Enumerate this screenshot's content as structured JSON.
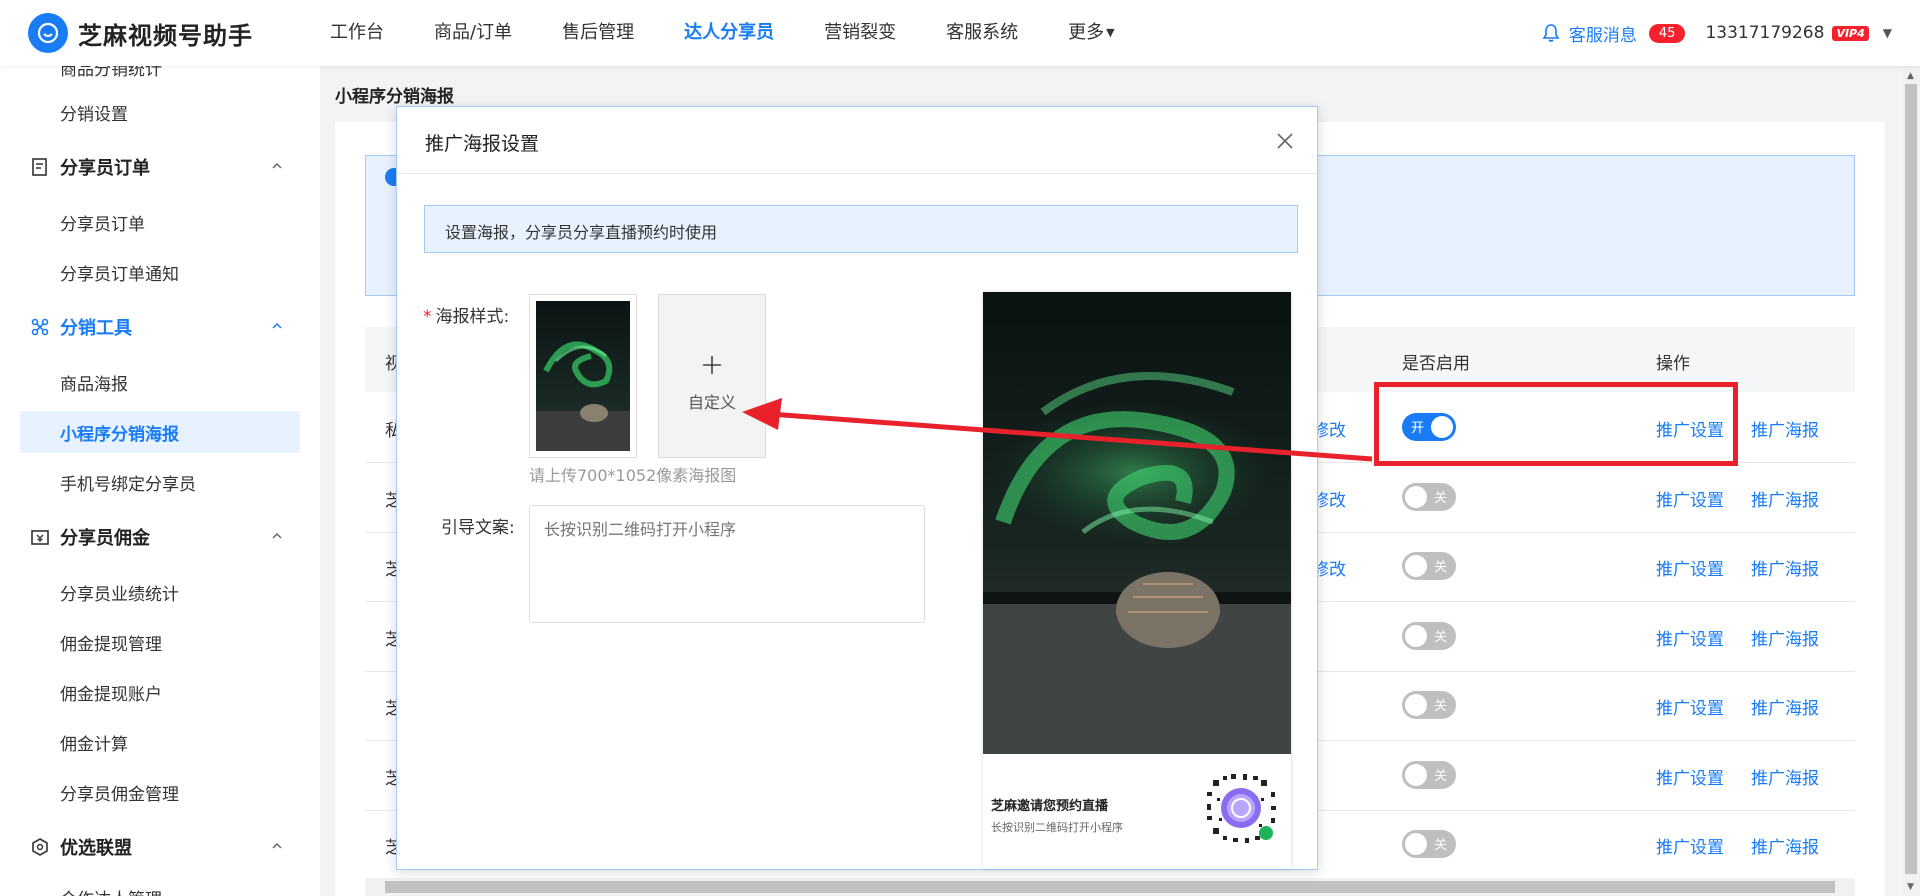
{
  "header": {
    "app_name": "芝麻视频号助手",
    "nav": [
      {
        "label": "工作台",
        "active": false
      },
      {
        "label": "商品/订单",
        "active": false
      },
      {
        "label": "售后管理",
        "active": false
      },
      {
        "label": "达人分享员",
        "active": true
      },
      {
        "label": "营销裂变",
        "active": false
      },
      {
        "label": "客服系统",
        "active": false
      },
      {
        "label": "更多",
        "active": false
      }
    ],
    "service_msg_label": "客服消息",
    "service_msg_count": "45",
    "account": "13317179268",
    "vip_badge": "VIP4"
  },
  "sidebar": {
    "items": [
      {
        "type": "sub",
        "label": "商品分销统计",
        "active": false
      },
      {
        "type": "sub",
        "label": "分销设置",
        "active": false
      },
      {
        "type": "group",
        "label": "分享员订单",
        "icon": "order-icon"
      },
      {
        "type": "sub",
        "label": "分享员订单",
        "active": false
      },
      {
        "type": "sub",
        "label": "分享员订单通知",
        "active": false
      },
      {
        "type": "group",
        "label": "分销工具",
        "icon": "tools-icon"
      },
      {
        "type": "sub",
        "label": "商品海报",
        "active": false
      },
      {
        "type": "sub",
        "label": "小程序分销海报",
        "active": true
      },
      {
        "type": "sub",
        "label": "手机号绑定分享员",
        "active": false
      },
      {
        "type": "group",
        "label": "分享员佣金",
        "icon": "commission-icon"
      },
      {
        "type": "sub",
        "label": "分享员业绩统计",
        "active": false
      },
      {
        "type": "sub",
        "label": "佣金提现管理",
        "active": false
      },
      {
        "type": "sub",
        "label": "佣金提现账户",
        "active": false
      },
      {
        "type": "sub",
        "label": "佣金计算",
        "active": false
      },
      {
        "type": "sub",
        "label": "分享员佣金管理",
        "active": false
      },
      {
        "type": "group",
        "label": "优选联盟",
        "icon": "alliance-icon"
      },
      {
        "type": "sub",
        "label": "合作达人管理",
        "active": false
      }
    ]
  },
  "page": {
    "title": "小程序分销海报",
    "table": {
      "headers": [
        "视",
        "是否启用",
        "操作"
      ],
      "rows": [
        {
          "first": "私",
          "edit": "修改",
          "enabled": true,
          "toggle_label": "开",
          "actions": [
            "推广设置",
            "推广海报"
          ]
        },
        {
          "first": "芝",
          "edit": "修改",
          "enabled": false,
          "toggle_label": "关",
          "actions": [
            "推广设置",
            "推广海报"
          ]
        },
        {
          "first": "芝",
          "edit": "修改",
          "enabled": false,
          "toggle_label": "关",
          "actions": [
            "推广设置",
            "推广海报"
          ]
        },
        {
          "first": "芝",
          "edit": "",
          "enabled": false,
          "toggle_label": "关",
          "actions": [
            "推广设置",
            "推广海报"
          ]
        },
        {
          "first": "芝",
          "edit": "",
          "enabled": false,
          "toggle_label": "关",
          "actions": [
            "推广设置",
            "推广海报"
          ]
        },
        {
          "first": "芝",
          "edit": "",
          "enabled": false,
          "toggle_label": "关",
          "actions": [
            "推广设置",
            "推广海报"
          ]
        },
        {
          "first": "芝",
          "edit": "",
          "enabled": false,
          "toggle_label": "关",
          "actions": [
            "推广设置",
            "推广海报"
          ]
        }
      ]
    }
  },
  "modal": {
    "title": "推广海报设置",
    "alert": "设置海报，分享员分享直播预约时使用",
    "poster_style_label": "海报样式:",
    "custom_label": "自定义",
    "upload_hint": "请上传700*1052像素海报图",
    "guide_label": "引导文案:",
    "guide_placeholder": "长按识别二维码打开小程序",
    "preview_title": "芝麻邀请您预约直播",
    "preview_subtitle": "长按识别二维码打开小程序"
  },
  "colors": {
    "accent": "#1a7cf5",
    "annotation_red": "#e8212b",
    "badge_red": "#f5222d"
  }
}
